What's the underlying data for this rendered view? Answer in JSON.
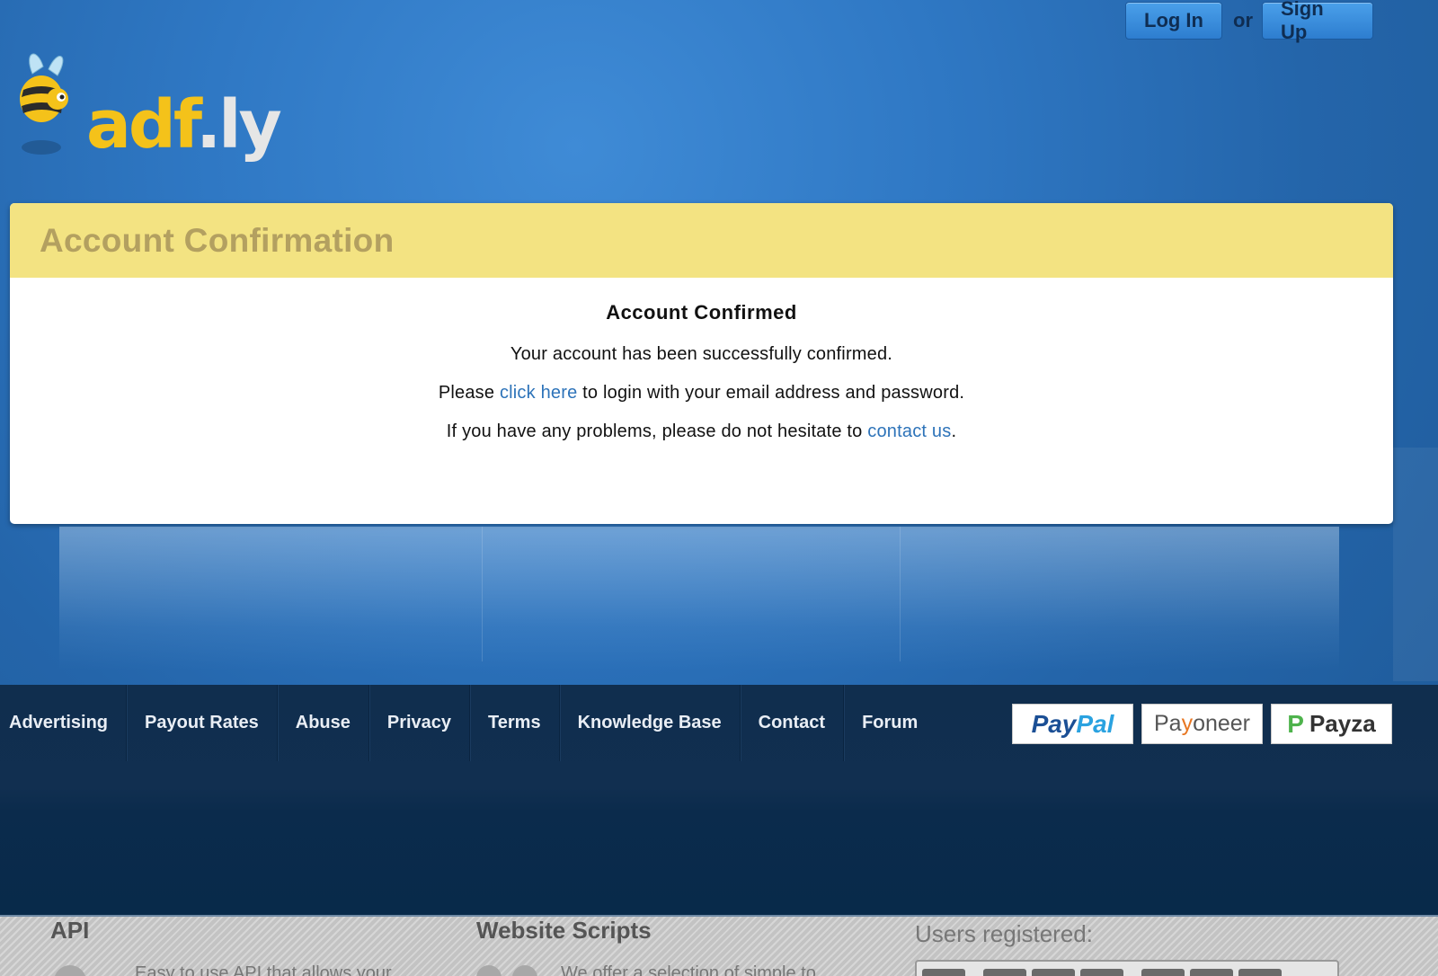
{
  "header": {
    "login_label": "Log In",
    "or_label": "or",
    "signup_label": "Sign Up",
    "logo_main": "adf",
    "logo_dot_ly": ".ly"
  },
  "card": {
    "title": "Account Confirmation",
    "heading": "Account Confirmed",
    "line1": "Your account has been successfully confirmed.",
    "line2_prefix": "Please ",
    "line2_link": "click here",
    "line2_suffix": " to login with your email address and password.",
    "line3_prefix": "If you have any problems, please do not hesitate to ",
    "line3_link": "contact us",
    "line3_suffix": "."
  },
  "footer": {
    "nav": [
      "Advertising",
      "Payout Rates",
      "Abuse",
      "Privacy",
      "Terms",
      "Knowledge Base",
      "Contact",
      "Forum"
    ],
    "payment_logos": {
      "paypal": [
        "Pay",
        "Pal"
      ],
      "payoneer": [
        "Pa",
        "y",
        "oneer"
      ],
      "payza": [
        "P",
        "Payza"
      ]
    }
  },
  "bottom": {
    "api_title": "API",
    "api_desc": "Easy to use API that allows your",
    "scripts_title": "Website Scripts",
    "scripts_desc": "We offer a selection of simple to",
    "users_label": "Users registered:"
  },
  "colors": {
    "background": "#2a6fb8",
    "card_header": "#f3e382",
    "card_title": "#b3a060",
    "link": "#2d73b9",
    "footer": "#102e4e"
  }
}
